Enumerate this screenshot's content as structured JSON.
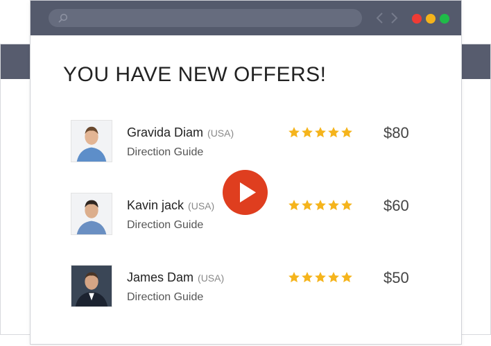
{
  "heading": "YOU HAVE NEW OFFERS!",
  "offers": [
    {
      "name": "Gravida Diam",
      "country": "(USA)",
      "role": "Direction Guide",
      "price": "$80",
      "rating": 5
    },
    {
      "name": "Kavin jack",
      "country": "(USA)",
      "role": "Direction Guide",
      "price": "$60",
      "rating": 5
    },
    {
      "name": "James Dam",
      "country": "(USA)",
      "role": "Direction Guide",
      "price": "$50",
      "rating": 5
    }
  ],
  "colors": {
    "titlebar": "#545a6c",
    "star": "#f5b41c",
    "play": "#df3e1f",
    "dot_close": "#ef3b35",
    "dot_min": "#f4b31b",
    "dot_max": "#1fbb48"
  },
  "icons": {
    "search": "search-icon",
    "back": "chevron-left-icon",
    "forward": "chevron-right-icon",
    "play": "play-icon",
    "star": "star-icon"
  }
}
